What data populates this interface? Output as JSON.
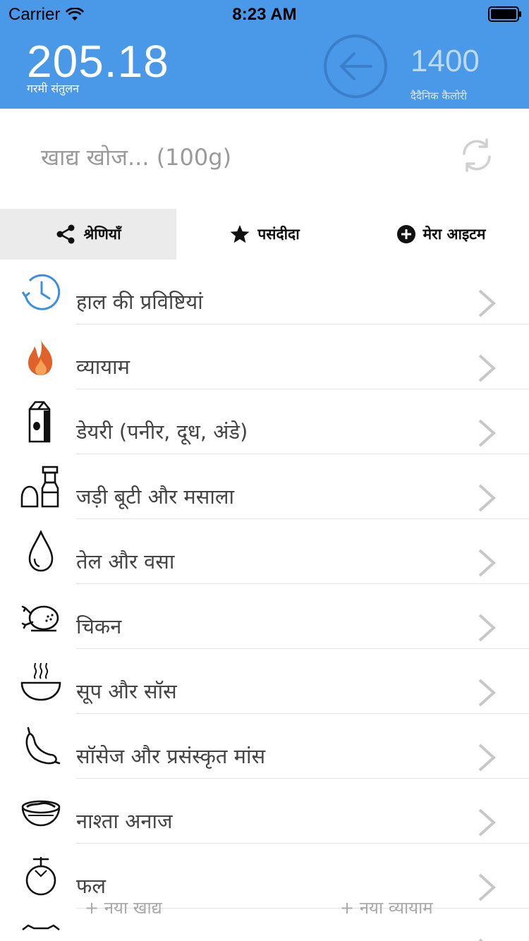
{
  "status": {
    "carrier": "Carrier",
    "time": "8:23 AM"
  },
  "header": {
    "balance_value": "205.18",
    "balance_label": "गरमी संतुलन",
    "daily_value": "1400",
    "daily_label": "दैदैनिक कैलोरी",
    "accent": "#4a98e8"
  },
  "search": {
    "placeholder": "खाद्य खोज... (100g)"
  },
  "tabs": [
    {
      "label": "श्रेणियाँ",
      "icon": "share-icon",
      "active": true
    },
    {
      "label": "पसंदीदा",
      "icon": "star-icon",
      "active": false
    },
    {
      "label": "मेरा आइटम",
      "icon": "plus-circle-icon",
      "active": false
    }
  ],
  "categories": [
    {
      "label": "हाल की प्रविष्टियां",
      "icon": "history-clock-icon"
    },
    {
      "label": "व्यायाम",
      "icon": "flame-icon"
    },
    {
      "label": "डेयरी (पनीर, दूध, अंडे)",
      "icon": "milk-carton-icon"
    },
    {
      "label": "जड़ी बूटी और मसाला",
      "icon": "salt-pepper-icon"
    },
    {
      "label": "तेल और वसा",
      "icon": "oil-drop-icon"
    },
    {
      "label": "चिकन",
      "icon": "chicken-icon"
    },
    {
      "label": "सूप और सॉस",
      "icon": "soup-bowl-icon"
    },
    {
      "label": "सॉसेज और प्रसंस्कृत मांस",
      "icon": "sausage-icon"
    },
    {
      "label": "नाश्ता अनाज",
      "icon": "cereal-bowl-icon"
    },
    {
      "label": "फल",
      "icon": "fruit-icon"
    }
  ],
  "bottom_actions": {
    "new_food": "+ नया खाद्य",
    "new_exercise": "+ नया व्यायाम"
  }
}
